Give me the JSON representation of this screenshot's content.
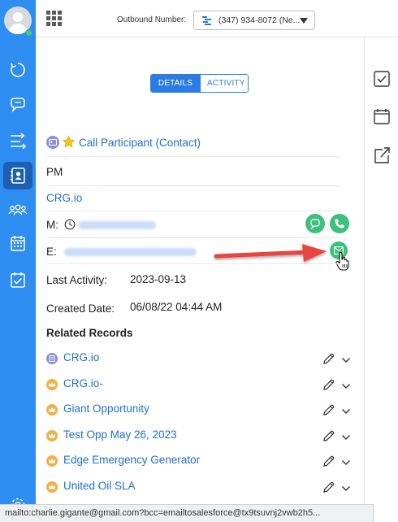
{
  "topbar": {
    "outbound_label": "Outbound Number:",
    "outbound_value": "(347) 934-8072 (Ne..."
  },
  "tabs": [
    {
      "label": "DETAILS",
      "active": true
    },
    {
      "label": "ACTIVITY",
      "active": false
    }
  ],
  "contact": {
    "header": "Call Participant (Contact)",
    "title": "PM",
    "account": "CRG.io",
    "mobile_label": "M:",
    "email_label": "E:",
    "last_activity_label": "Last Activity:",
    "last_activity_value": "2023-09-13",
    "created_label": "Created Date:",
    "created_value": "06/08/22 04:44 AM"
  },
  "related": {
    "title": "Related Records",
    "items": [
      {
        "name": "CRG.io",
        "icon": "account-icon",
        "color": "#8b8fd8"
      },
      {
        "name": "CRG.io-",
        "icon": "crown-icon",
        "color": "#f0b04a"
      },
      {
        "name": "Giant Opportunity",
        "icon": "crown-icon",
        "color": "#f0b04a"
      },
      {
        "name": "Test Opp May 26, 2023",
        "icon": "crown-icon",
        "color": "#f0b04a"
      },
      {
        "name": "Edge Emergency Generator",
        "icon": "crown-icon",
        "color": "#f0b04a"
      },
      {
        "name": "United Oil SLA",
        "icon": "crown-icon",
        "color": "#f0b04a"
      }
    ]
  },
  "statusbar": {
    "text": "mailto:charlie.gigante@gmail.com?bcc=emailtosalesforce@tx9tsuvnj2vwb2h5..."
  },
  "colors": {
    "sidebar": "#2e8df0",
    "accent": "#2b7be0",
    "action_green": "#3cc07b",
    "arrow_red": "#e8453c"
  }
}
